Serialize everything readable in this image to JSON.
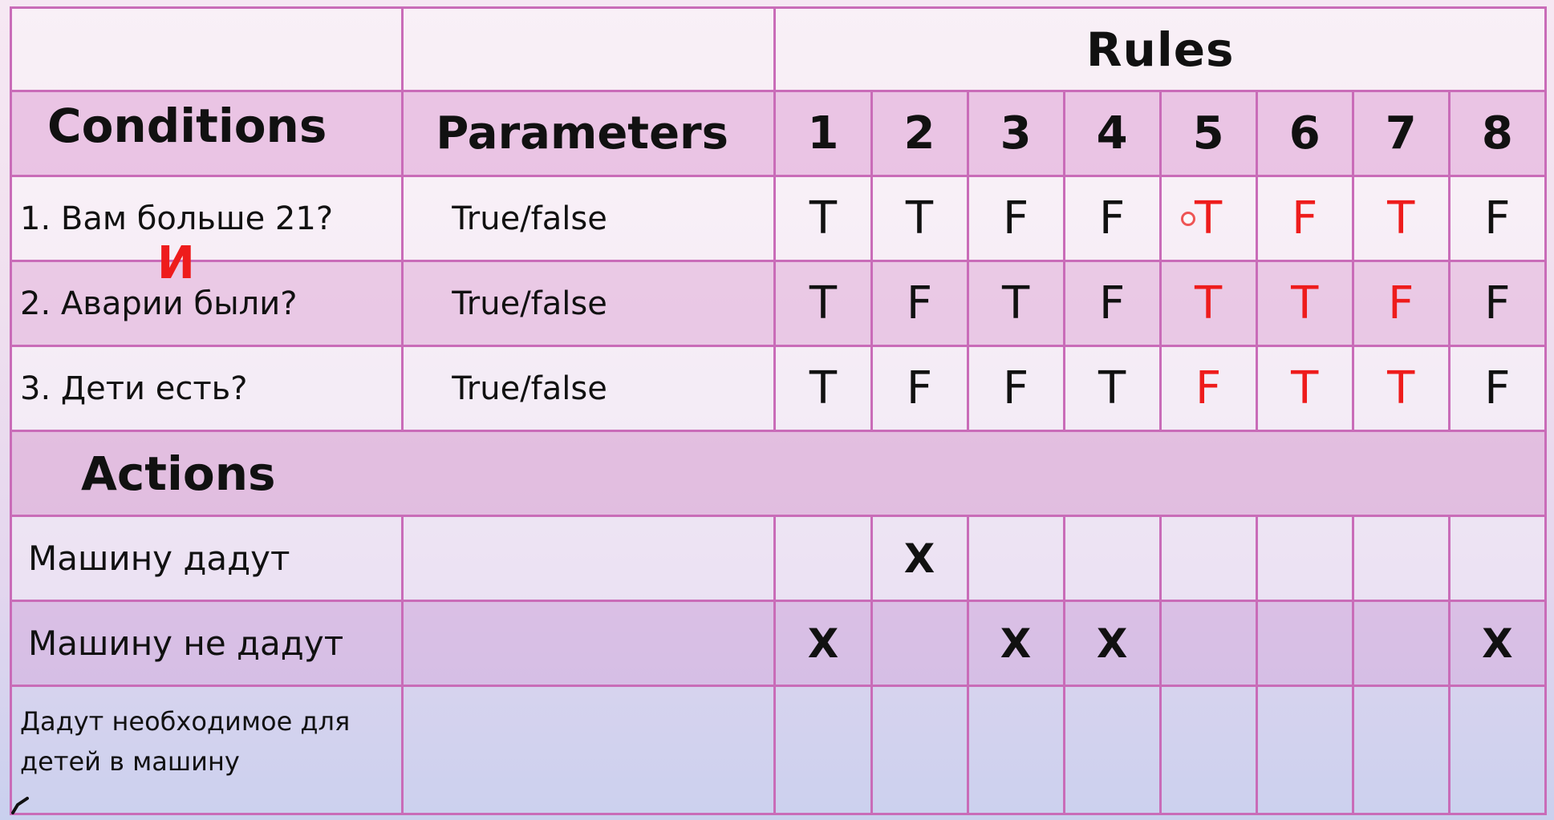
{
  "table": {
    "rules_title": "Rules",
    "conditions_header": "Conditions",
    "parameters_header": "Parameters",
    "rule_numbers": [
      "1",
      "2",
      "3",
      "4",
      "5",
      "6",
      "7",
      "8"
    ],
    "conditions": [
      {
        "label": "1. Вам больше 21?",
        "parameter": "True/false",
        "values": [
          "T",
          "T",
          "F",
          "F",
          "T",
          "F",
          "T",
          "F"
        ]
      },
      {
        "label": "2. Аварии были?",
        "parameter": "True/false",
        "values": [
          "T",
          "F",
          "T",
          "F",
          "T",
          "T",
          "F",
          "F"
        ]
      },
      {
        "label": "3. Дети есть?",
        "parameter": "True/false",
        "values": [
          "T",
          "F",
          "F",
          "T",
          "F",
          "T",
          "T",
          "F"
        ]
      }
    ],
    "highlight_color": "#ee1c1c",
    "highlighted_rules": [
      5,
      6,
      7
    ],
    "actions_header": "Actions",
    "actions": [
      {
        "label": "Машину дадут",
        "marks": [
          "",
          "X",
          "",
          "",
          "",
          "",
          "",
          ""
        ]
      },
      {
        "label": "Машину не дадут",
        "marks": [
          "X",
          "",
          "X",
          "X",
          "",
          "",
          "",
          "X"
        ]
      },
      {
        "label": "Дадут необходимое для детей в машину",
        "marks": [
          "",
          "",
          "",
          "",
          "",
          "",
          "",
          ""
        ]
      }
    ]
  },
  "annotation": {
    "text": "И"
  }
}
